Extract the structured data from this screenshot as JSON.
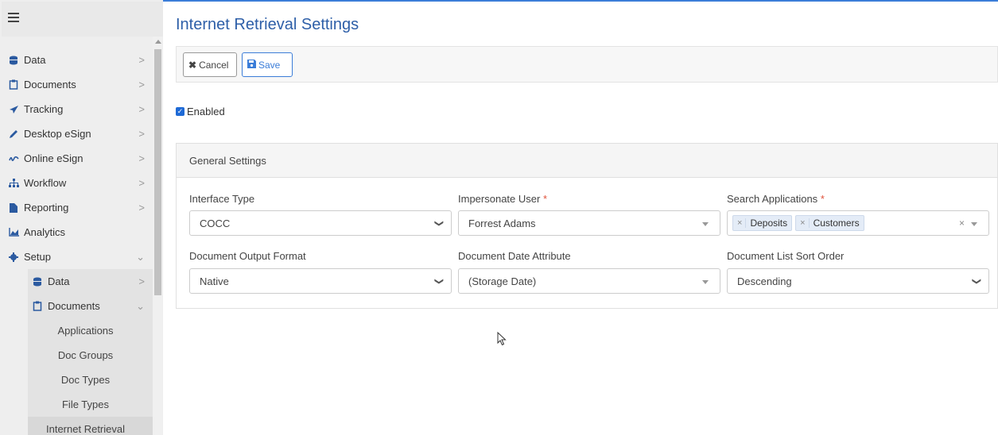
{
  "sidebar": {
    "items": [
      {
        "label": "Data",
        "icon": "database-icon"
      },
      {
        "label": "Documents",
        "icon": "clipboard-icon"
      },
      {
        "label": "Tracking",
        "icon": "paper-plane-icon"
      },
      {
        "label": "Desktop eSign",
        "icon": "pencil-icon"
      },
      {
        "label": "Online eSign",
        "icon": "signature-icon"
      },
      {
        "label": "Workflow",
        "icon": "sitemap-icon"
      },
      {
        "label": "Reporting",
        "icon": "file-icon"
      },
      {
        "label": "Analytics",
        "icon": "area-chart-icon"
      },
      {
        "label": "Setup",
        "icon": "gear-icon"
      }
    ],
    "setup_children": [
      {
        "label": "Data",
        "icon": "database-icon"
      },
      {
        "label": "Documents",
        "icon": "clipboard-icon"
      }
    ],
    "documents_children": [
      "Applications",
      "Doc Groups",
      "Doc Types",
      "File Types",
      "Internet Retrieval"
    ]
  },
  "page": {
    "title": "Internet Retrieval Settings"
  },
  "toolbar": {
    "cancel_label": "Cancel",
    "save_label": "Save"
  },
  "enabled": {
    "label": "Enabled",
    "checked": true
  },
  "general_settings": {
    "header": "General Settings",
    "interface_type": {
      "label": "Interface Type",
      "value": "COCC"
    },
    "impersonate_user": {
      "label": "Impersonate User",
      "required": "*",
      "value": "Forrest Adams"
    },
    "search_applications": {
      "label": "Search Applications",
      "required": "*",
      "tags": [
        "Deposits",
        "Customers"
      ]
    },
    "document_output_format": {
      "label": "Document Output Format",
      "value": "Native"
    },
    "document_date_attribute": {
      "label": "Document Date Attribute",
      "value": "(Storage Date)"
    },
    "document_list_sort_order": {
      "label": "Document List Sort Order",
      "value": "Descending"
    }
  },
  "colors": {
    "accent": "#2e5fa8",
    "checkbox": "#1f6ad6",
    "required": "#e0533c"
  }
}
